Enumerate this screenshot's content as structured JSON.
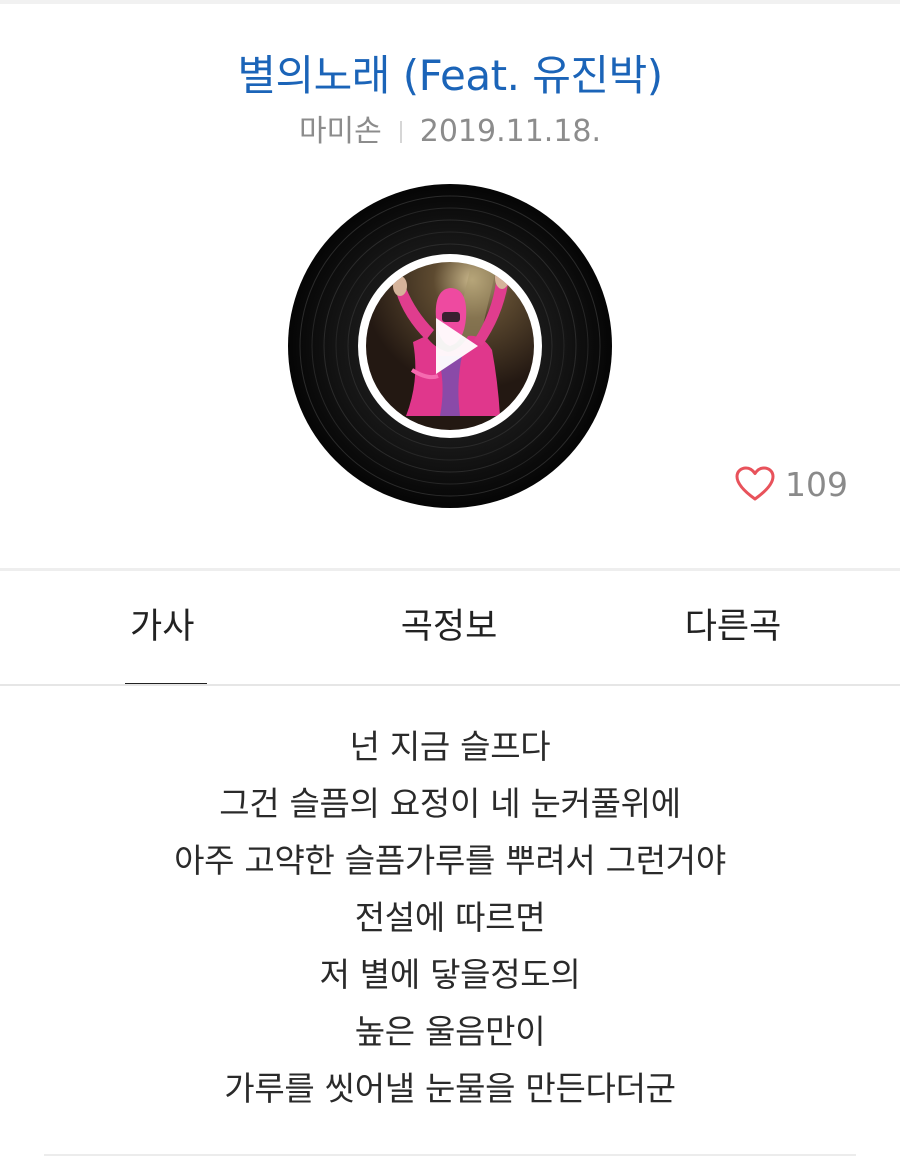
{
  "song": {
    "title": "별의노래 (Feat. 유진박)",
    "artist": "마미손",
    "date": "2019.11.18."
  },
  "player": {
    "cover_icon": "album-cover",
    "play_icon": "play-icon"
  },
  "likes": {
    "icon": "heart-outline-icon",
    "count": "109",
    "color": "#e8525b"
  },
  "tabs": [
    {
      "label": "가사",
      "active": true
    },
    {
      "label": "곡정보",
      "active": false
    },
    {
      "label": "다른곡",
      "active": false
    }
  ],
  "lyrics": [
    "넌 지금 슬프다",
    "그건 슬픔의 요정이 네 눈커풀위에",
    "아주 고약한 슬픔가루를 뿌려서 그런거야",
    "전설에 따르면",
    "저 별에 닿을정도의",
    "높은 울음만이",
    "가루를 씻어낼 눈물을 만든다더군"
  ],
  "colors": {
    "title": "#1b64b8",
    "meta": "#8c8c8c",
    "text": "#222222"
  }
}
